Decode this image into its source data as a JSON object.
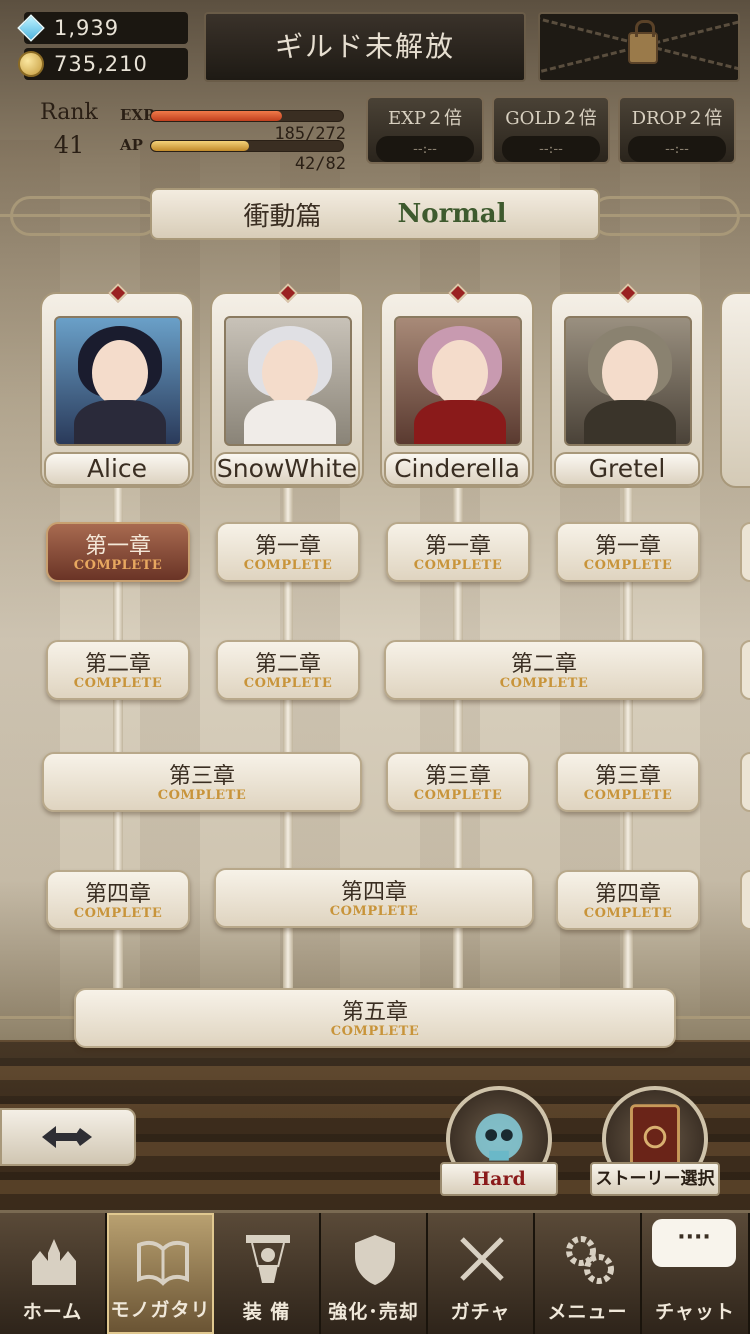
{
  "currency": {
    "gems": "1,939",
    "gold": "735,210"
  },
  "guild": {
    "label": "ギルド未解放"
  },
  "player": {
    "rank_label": "Rank",
    "rank": "41",
    "exp_label": "EXP",
    "exp_value": "185/272",
    "exp_fraction": 0.68,
    "ap_label": "AP",
    "ap_value": "42/82",
    "ap_fraction": 0.51
  },
  "boosts": [
    {
      "label": "EXP２倍",
      "timer": "--:--"
    },
    {
      "label": "GOLD２倍",
      "timer": "--:--"
    },
    {
      "label": "DROP２倍",
      "timer": "--:--"
    }
  ],
  "mode": {
    "chapter": "衝動篇",
    "difficulty": "Normal"
  },
  "characters": [
    {
      "name": "Alice"
    },
    {
      "name": "SnowWhite"
    },
    {
      "name": "Cinderella"
    },
    {
      "name": "Gretel"
    }
  ],
  "chapters": {
    "ch1": "第一章",
    "ch2": "第二章",
    "ch3": "第三章",
    "ch4": "第四章",
    "ch5": "第五章",
    "status": "COMPLETE"
  },
  "buttons": {
    "hard": "Hard",
    "story_select": "ストーリー選択"
  },
  "nav": [
    {
      "label": "ホーム",
      "icon": "castle-icon"
    },
    {
      "label": "モノガタリ",
      "icon": "book-icon"
    },
    {
      "label": "装 備",
      "icon": "puppet-icon"
    },
    {
      "label": "強化･売却",
      "icon": "shield-icon"
    },
    {
      "label": "ガチャ",
      "icon": "crossed-swords-icon"
    },
    {
      "label": "メニュー",
      "icon": "gears-icon"
    },
    {
      "label": "チャット",
      "icon": "chat-bubble-icon",
      "bubble": "····"
    }
  ]
}
